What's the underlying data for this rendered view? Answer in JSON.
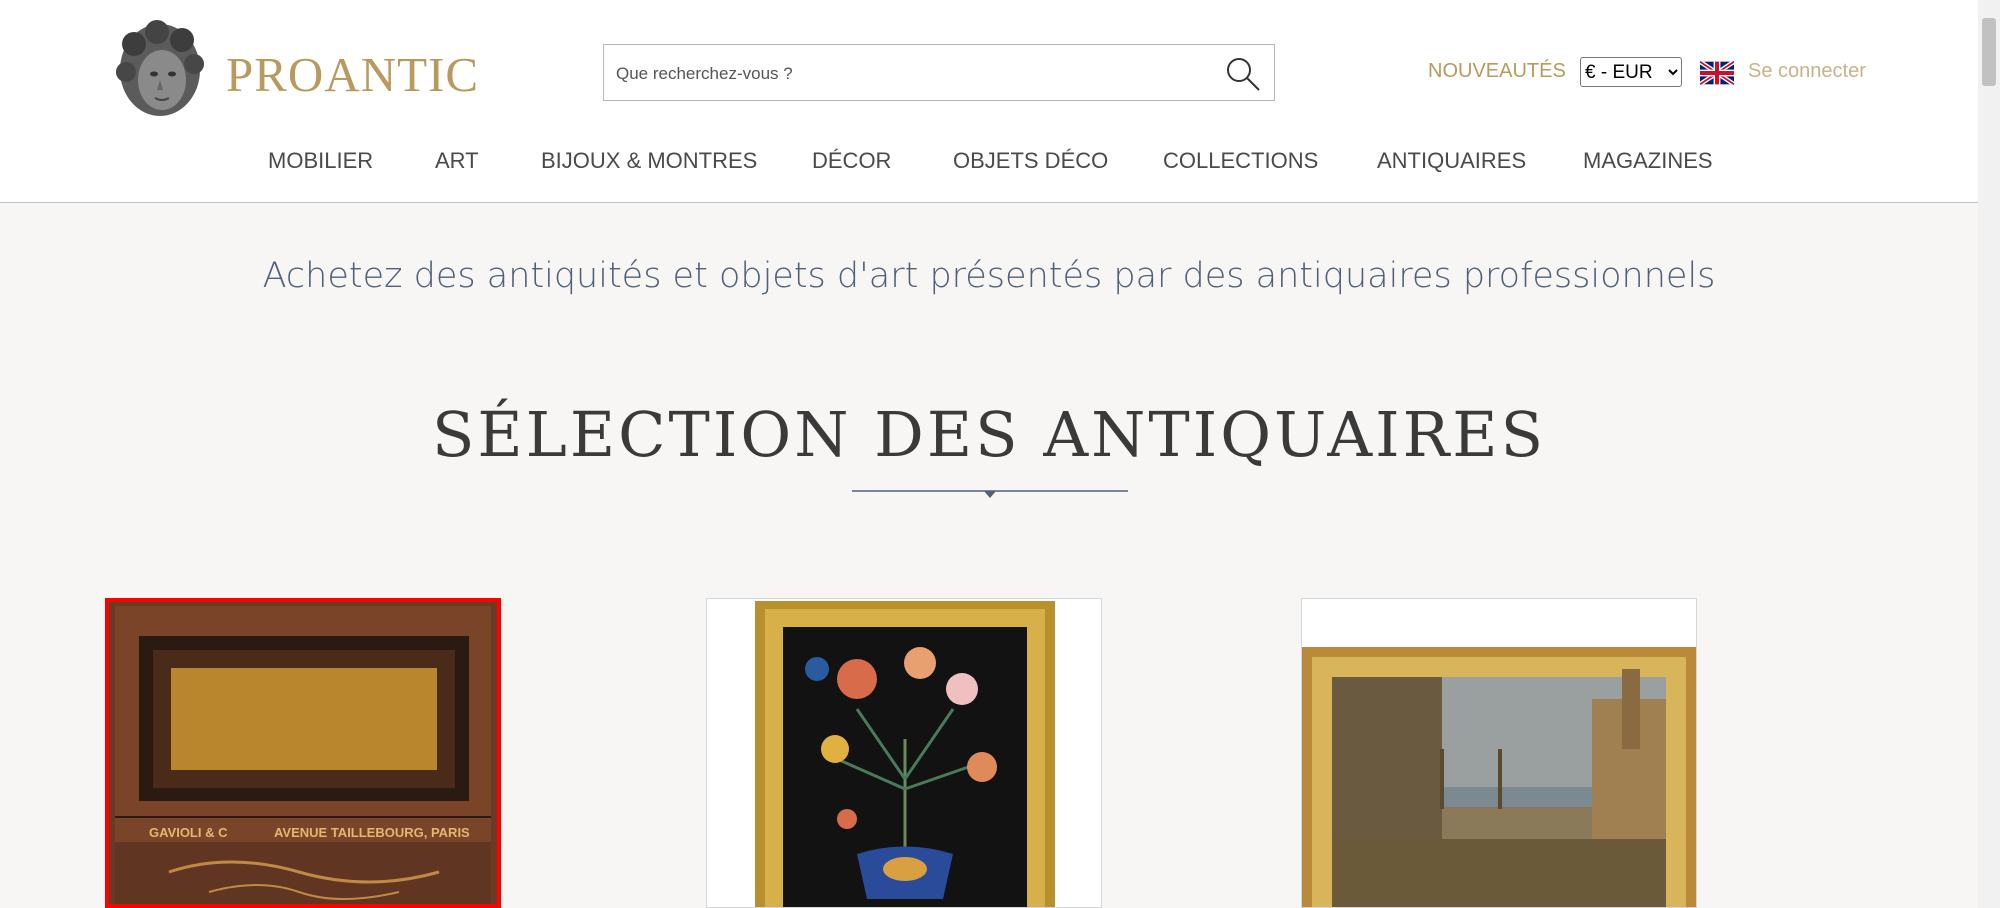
{
  "brand": {
    "name": "PROANTIC"
  },
  "search": {
    "placeholder": "Que recherchez-vous ?"
  },
  "header_links": {
    "new": "NOUVEAUTÉS",
    "login": "Se connecter"
  },
  "currency": {
    "selected": "€ - EUR"
  },
  "nav": [
    "MOBILIER",
    "ART",
    "BIJOUX & MONTRES",
    "DÉCOR",
    "OBJETS DÉCO",
    "COLLECTIONS",
    "ANTIQUAIRES",
    "MAGAZINES"
  ],
  "tagline": "Achetez des antiquités et objets d'art présentés par des antiquaires professionnels",
  "section_title": "SÉLECTION DES ANTIQUAIRES",
  "cards": [
    {
      "inscription": "GAVIOLI & C"
    }
  ],
  "colors": {
    "brand_gold": "#b89a5e",
    "tagline_blue": "#4f6078",
    "highlight_red": "#ff0000"
  }
}
